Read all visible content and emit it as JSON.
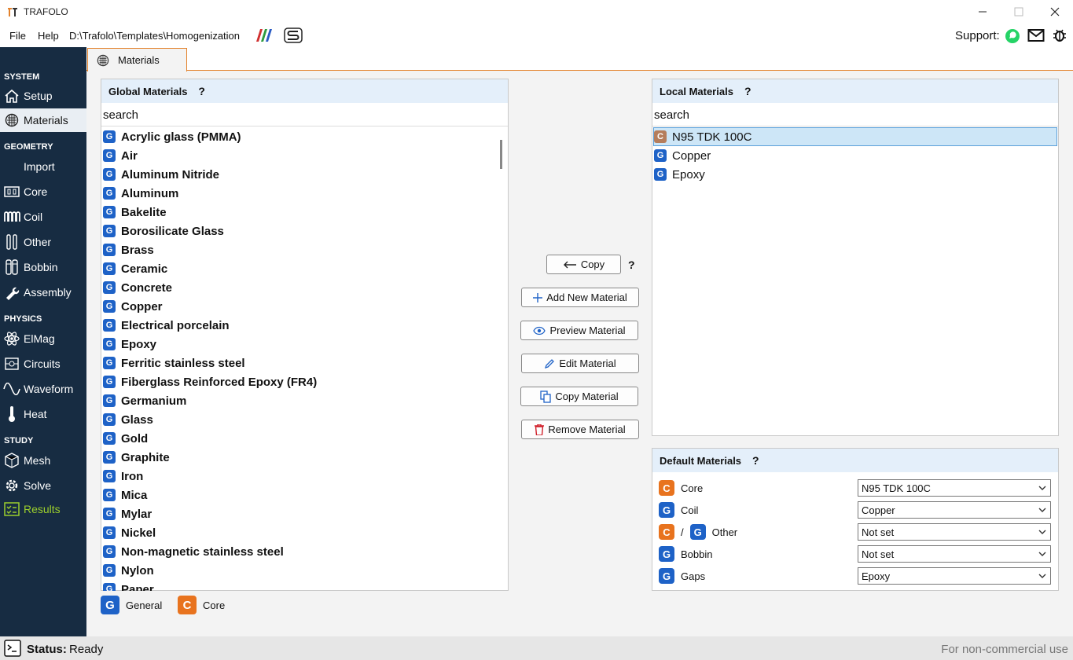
{
  "window": {
    "title": "TRAFOLO"
  },
  "menu": {
    "file": "File",
    "help": "Help",
    "path": "D:\\Trafolo\\Templates\\Homogenization"
  },
  "support": {
    "label": "Support:"
  },
  "sidebar": {
    "system": "SYSTEM",
    "setup": "Setup",
    "materials": "Materials",
    "geometry": "GEOMETRY",
    "import": "Import",
    "core": "Core",
    "coil": "Coil",
    "other": "Other",
    "bobbin": "Bobbin",
    "assembly": "Assembly",
    "physics": "PHYSICS",
    "elmag": "ElMag",
    "circuits": "Circuits",
    "waveform": "Waveform",
    "heat": "Heat",
    "study": "STUDY",
    "mesh": "Mesh",
    "solve": "Solve",
    "results": "Results"
  },
  "tab": {
    "label": "Materials"
  },
  "global": {
    "title": "Global Materials",
    "help": "?",
    "search": "search",
    "badge": "G",
    "items": [
      "Acrylic glass (PMMA)",
      "Air",
      "Aluminum Nitride",
      "Aluminum",
      "Bakelite",
      "Borosilicate Glass",
      "Brass",
      "Ceramic",
      "Concrete",
      "Copper",
      "Electrical porcelain",
      "Epoxy",
      "Ferritic stainless steel",
      "Fiberglass Reinforced Epoxy (FR4)",
      "Germanium",
      "Glass",
      "Gold",
      "Graphite",
      "Iron",
      "Mica",
      "Mylar",
      "Nickel",
      "Non-magnetic stainless steel",
      "Nylon",
      "Paper"
    ]
  },
  "local": {
    "title": "Local Materials",
    "help": "?",
    "search": "search",
    "items": [
      {
        "badge": "C",
        "label": "N95 TDK 100C"
      },
      {
        "badge": "G",
        "label": "Copper"
      },
      {
        "badge": "G",
        "label": "Epoxy"
      }
    ]
  },
  "actions": {
    "copy": "Copy",
    "copy_help": "?",
    "add": "Add New Material",
    "preview": "Preview Material",
    "edit": "Edit Material",
    "copy_material": "Copy Material",
    "remove": "Remove Material"
  },
  "defaults": {
    "title": "Default Materials",
    "help": "?",
    "slash": "/",
    "rows": [
      {
        "badge": "C",
        "label": "Core",
        "value": "N95 TDK 100C"
      },
      {
        "badge": "G",
        "label": "Coil",
        "value": "Copper"
      },
      {
        "badge": "C",
        "badge2": "G",
        "label": "Other",
        "value": "Not set"
      },
      {
        "badge": "G",
        "label": "Bobbin",
        "value": "Not set"
      },
      {
        "badge": "G",
        "label": "Gaps",
        "value": "Epoxy"
      }
    ]
  },
  "legend": {
    "general_badge": "G",
    "general": "General",
    "core_badge": "C",
    "core": "Core"
  },
  "status": {
    "label": "Status:",
    "value": "Ready",
    "note": "For non-commercial use"
  },
  "colors": {
    "sidebar": "#172c42",
    "accent": "#e3822c",
    "general": "#1e62c7",
    "core": "#e8731e",
    "results": "#9ccf2c",
    "header": "#e4effa"
  }
}
